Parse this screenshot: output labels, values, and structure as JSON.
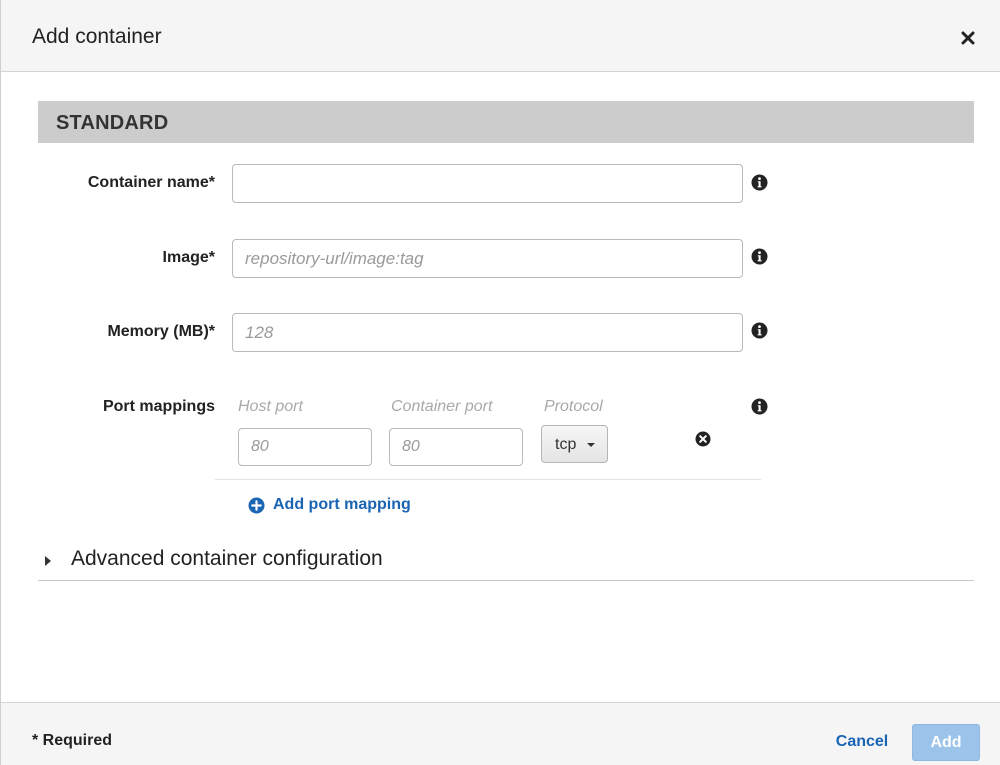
{
  "dialog": {
    "title": "Add container"
  },
  "section": {
    "title": "STANDARD"
  },
  "form": {
    "container_name": {
      "label": "Container name*",
      "value": "",
      "placeholder": ""
    },
    "image": {
      "label": "Image*",
      "value": "",
      "placeholder": "repository-url/image:tag"
    },
    "memory": {
      "label": "Memory (MB)*",
      "value": "",
      "placeholder": "128"
    },
    "port_mappings": {
      "label": "Port mappings",
      "columns": {
        "host_port": "Host port",
        "container_port": "Container port",
        "protocol": "Protocol"
      },
      "rows": [
        {
          "host_port_placeholder": "80",
          "container_port_placeholder": "80",
          "protocol": "tcp"
        }
      ],
      "add_label": "Add port mapping"
    }
  },
  "advanced": {
    "label": "Advanced container configuration"
  },
  "footer": {
    "required_note": "* Required",
    "cancel_label": "Cancel",
    "add_label": "Add"
  },
  "colors": {
    "link": "#1a64b4",
    "primary_disabled": "#9cc3ea",
    "section_bar": "#cccccc"
  },
  "icons": {
    "close": "close-icon",
    "info": "info-icon",
    "remove": "remove-circle-icon",
    "add": "plus-circle-icon",
    "expand": "triangle-right-icon"
  }
}
